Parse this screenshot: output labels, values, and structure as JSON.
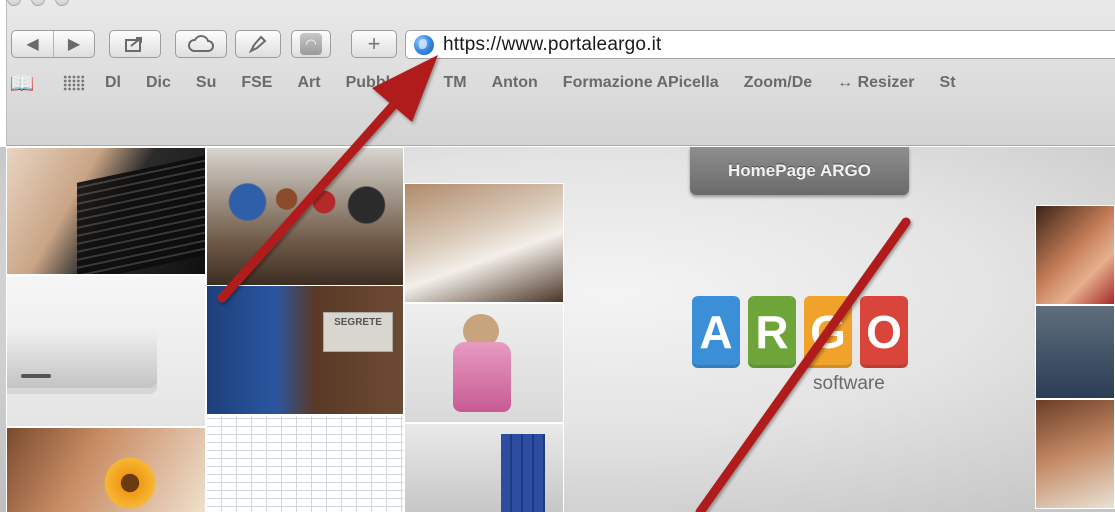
{
  "toolbar": {
    "back_icon": "◀",
    "forward_icon": "▶",
    "new_tab_icon": "+"
  },
  "address_bar": {
    "url": "https://www.portaleargo.it"
  },
  "bookmarks": [
    "Dl",
    "Dic",
    "Su",
    "FSE",
    "Art",
    "PubblosL",
    "TM",
    "Anton",
    "Formazione APicella",
    "Zoom/De",
    "↔ Resizer",
    "St"
  ],
  "page": {
    "homepage_tab": "HomePage ARGO",
    "logo_letters": [
      "A",
      "R",
      "G",
      "O"
    ],
    "logo_colors": [
      "#3b8fd6",
      "#6ea53b",
      "#f0a22a",
      "#d9453a"
    ],
    "logo_subtitle": "software",
    "sign_text": "SEGRETE"
  },
  "colors": {
    "annotation_arrow": "#b01e1e"
  }
}
